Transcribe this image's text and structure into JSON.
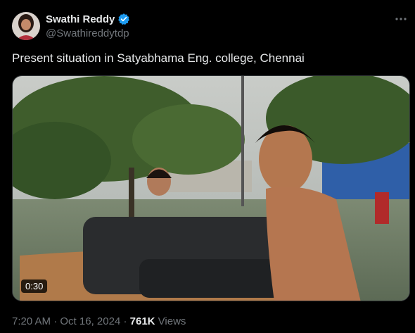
{
  "author": {
    "display_name": "Swathi Reddy",
    "handle": "@Swathireddytdp",
    "verified": true,
    "verified_color": "#1d9bf0"
  },
  "tweet": {
    "text": "Present situation in Satyabhama Eng. college, Chennai"
  },
  "media": {
    "type": "video",
    "duration": "0:30"
  },
  "meta": {
    "time": "7:20 AM",
    "separator": " · ",
    "date": "Oct 16, 2024",
    "separator2": " · ",
    "views_count": "761K",
    "views_label": " Views"
  },
  "icons": {
    "more": "more-dots-icon",
    "verified": "verified-badge-icon"
  },
  "colors": {
    "background": "#000000",
    "text": "#e7e9ea",
    "muted": "#71767b",
    "border": "#2f3336"
  }
}
